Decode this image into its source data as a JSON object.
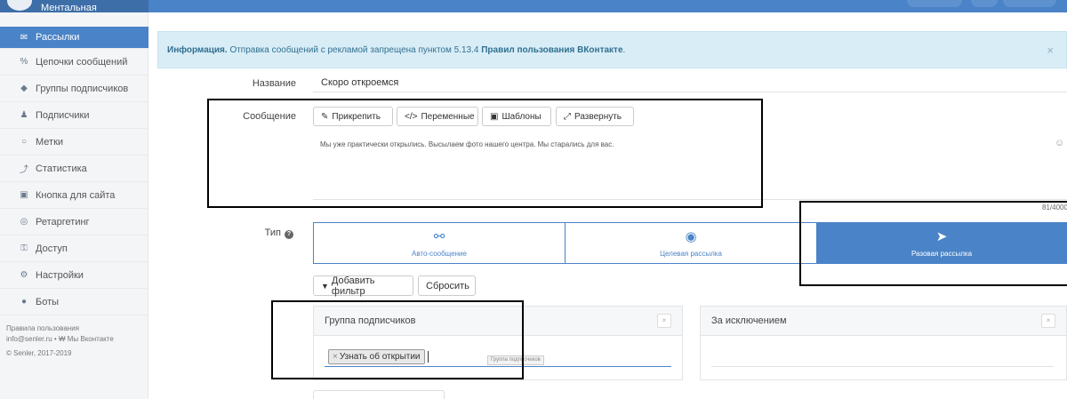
{
  "brand": {
    "name": "Ментальная"
  },
  "sidebar": {
    "items": [
      {
        "label": "Рассылки",
        "icon": "envelope-icon",
        "glyph": "✉",
        "active": true
      },
      {
        "label": "Цепочки сообщений",
        "icon": "chain-icon",
        "glyph": "%"
      },
      {
        "label": "Группы подписчиков",
        "icon": "tag-icon",
        "glyph": "◆"
      },
      {
        "label": "Подписчики",
        "icon": "users-icon",
        "glyph": "♟"
      },
      {
        "label": "Метки",
        "icon": "circle-icon",
        "glyph": "○"
      },
      {
        "label": "Статистика",
        "icon": "chart-icon",
        "glyph": "⤴"
      },
      {
        "label": "Кнопка для сайта",
        "icon": "code-icon",
        "glyph": "▣"
      },
      {
        "label": "Ретаргетинг",
        "icon": "target-icon",
        "glyph": "◎"
      },
      {
        "label": "Доступ",
        "icon": "key-icon",
        "glyph": "⚿"
      },
      {
        "label": "Настройки",
        "icon": "gear-icon",
        "glyph": "⚙"
      },
      {
        "label": "Боты",
        "icon": "bot-icon",
        "glyph": "●"
      }
    ],
    "footer": {
      "terms": "Правила пользования",
      "contacts": "info@senler.ru • ₩ Мы Вконтакте",
      "copyright": "© Senler, 2017-2019"
    }
  },
  "alert": {
    "strong": "Информация.",
    "text": " Отправка сообщений с рекламой запрещена пунктом 5.13.4 ",
    "link": "Правил пользования ВКонтакте",
    "suffix": ".",
    "close": "×"
  },
  "form": {
    "name_label": "Название",
    "name_value": "Скоро откроемся",
    "message_label": "Сообщение",
    "toolbar": {
      "attach": "Прикрепить",
      "variables": "Переменные",
      "templates": "Шаблоны",
      "expand": "Развернуть"
    },
    "message_text": "Мы уже практически открылись. Высылаем фото нашего центра. Мы старались для вас.",
    "emoji": "☺",
    "counter": "81/4000",
    "type_label": "Тип",
    "types": [
      {
        "label": "Авто-сообщение",
        "icon": "link-icon",
        "glyph": "⚯"
      },
      {
        "label": "Целевая рассылка",
        "icon": "target-icon",
        "glyph": "◉"
      },
      {
        "label": "Разовая рассылка",
        "icon": "paper-plane-icon",
        "glyph": "➤",
        "selected": true
      }
    ],
    "add_filter": "Добавить фильтр",
    "reset": "Сбросить",
    "group_panel": {
      "title": "Группа подписчиков",
      "tag": "Узнать об открытии",
      "tag_remove": "×",
      "tooltip": "Группа подписчиков"
    },
    "except_panel": {
      "title": "За исключением"
    },
    "panel_close": "×"
  }
}
